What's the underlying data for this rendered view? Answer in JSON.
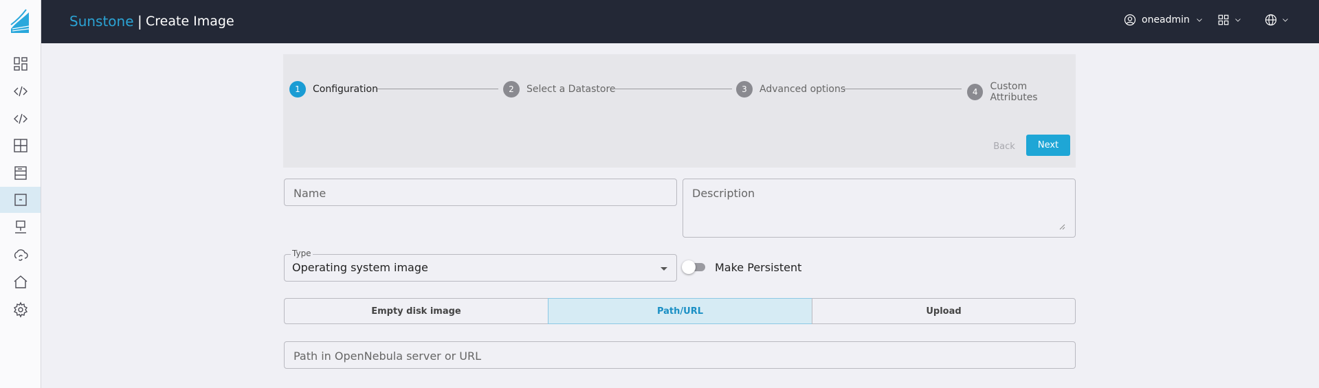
{
  "header": {
    "brand": "Sunstone",
    "separator": "|",
    "title": "Create Image",
    "user": "oneadmin"
  },
  "sidebar": {
    "items": [
      {
        "icon": "dashboard-icon"
      },
      {
        "icon": "code-icon"
      },
      {
        "icon": "code-icon"
      },
      {
        "icon": "grid-icon"
      },
      {
        "icon": "storage-icon"
      },
      {
        "icon": "image-icon",
        "active": true
      },
      {
        "icon": "network-icon"
      },
      {
        "icon": "cloud-sync-icon"
      },
      {
        "icon": "home-icon"
      },
      {
        "icon": "settings-icon"
      }
    ]
  },
  "stepper": {
    "steps": [
      {
        "num": "1",
        "label": "Configuration",
        "active": true
      },
      {
        "num": "2",
        "label": "Select a Datastore"
      },
      {
        "num": "3",
        "label": "Advanced options"
      },
      {
        "num": "4",
        "label": "Custom Attributes"
      }
    ],
    "back_label": "Back",
    "next_label": "Next"
  },
  "form": {
    "name_placeholder": "Name",
    "description_placeholder": "Description",
    "type_label": "Type",
    "type_value": "Operating system image",
    "persistent_label": "Make Persistent",
    "persistent_on": false,
    "source_options": [
      "Empty disk image",
      "Path/URL",
      "Upload"
    ],
    "source_selected": "Path/URL",
    "path_placeholder": "Path in OpenNebula server or URL"
  },
  "colors": {
    "accent": "#1ea6d6",
    "topbar": "#232836",
    "brand": "#2ba3d4"
  }
}
